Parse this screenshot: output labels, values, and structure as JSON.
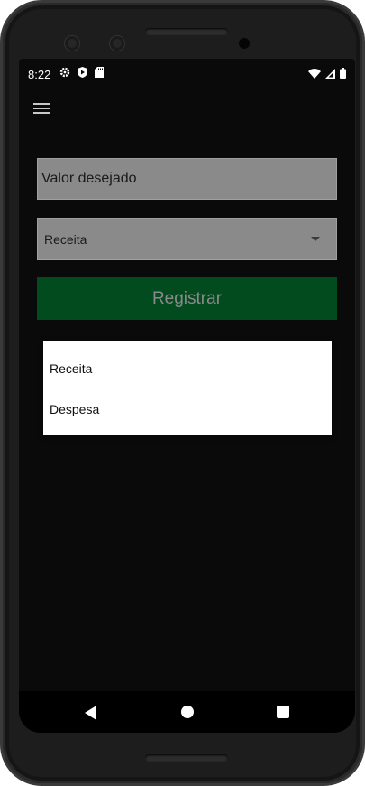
{
  "status_bar": {
    "time": "8:22",
    "left_icons": [
      "gear-icon",
      "play-protect-icon",
      "sd-card-icon"
    ],
    "right_icons": [
      "wifi-icon",
      "cell-signal-icon",
      "battery-icon"
    ]
  },
  "app_bar": {
    "menu_icon": "hamburger-menu-icon"
  },
  "form": {
    "valor_placeholder": "Valor desejado",
    "tipo_selected": "Receita",
    "register_label": "Registrar"
  },
  "dropdown": {
    "options": [
      "Receita",
      "Despesa"
    ]
  },
  "nav_bar": {
    "icons": [
      "back-icon",
      "home-icon",
      "recents-icon"
    ]
  },
  "colors": {
    "screen_bg": "#0a0a0a",
    "field_bg": "#8a8a8a",
    "button_bg": "#024b1f",
    "button_text": "#8a8a8a",
    "dropdown_bg": "#ffffff"
  }
}
